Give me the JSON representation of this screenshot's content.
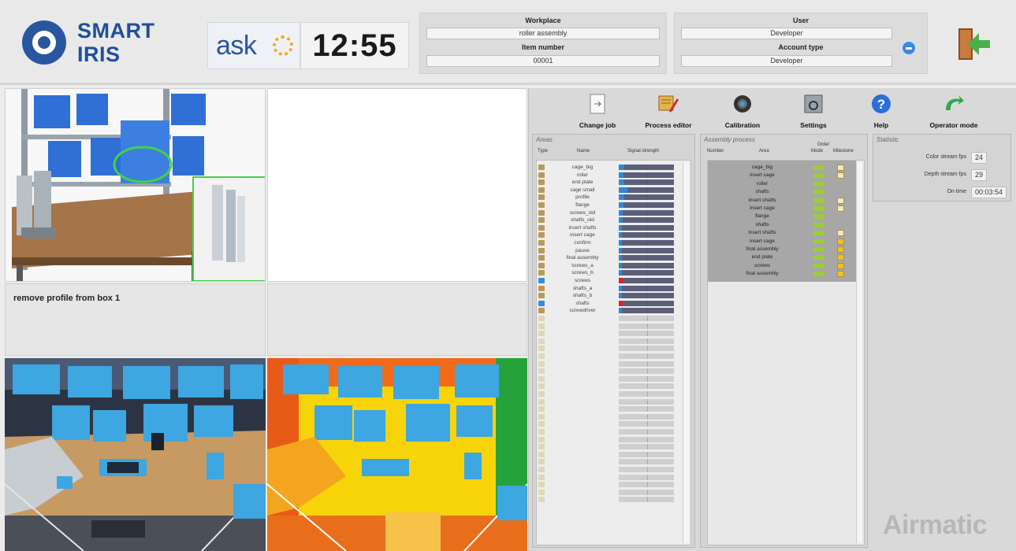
{
  "header": {
    "logo_text_line1": "SMART",
    "logo_text_line2": "IRIS",
    "ask_logo": "ask",
    "clock": "12:55",
    "workplace_label": "Workplace",
    "workplace_value": "roller assembly",
    "item_label": "Item number",
    "item_value": "00001",
    "user_label": "User",
    "user_value": "Developer",
    "account_label": "Account type",
    "account_value": "Developer",
    "exit_icon": "exit-door-icon"
  },
  "instruction": "remove profile from box 1",
  "toolbar": [
    {
      "label": "Change job",
      "icon": "change-job-icon"
    },
    {
      "label": "Process editor",
      "icon": "process-editor-icon"
    },
    {
      "label": "Calibration",
      "icon": "calibration-icon"
    },
    {
      "label": "Settings",
      "icon": "settings-icon"
    },
    {
      "label": "Help",
      "icon": "help-icon"
    },
    {
      "label": "Operator mode",
      "icon": "operator-mode-icon"
    }
  ],
  "areas": {
    "title": "Areas",
    "col_type": "Type",
    "col_name": "Name",
    "col_signal": "Signal strength",
    "items": [
      {
        "type": "box",
        "name": "cage_big",
        "signal": 0.1
      },
      {
        "type": "box",
        "name": "roller",
        "signal": 0.08
      },
      {
        "type": "box",
        "name": "end plate",
        "signal": 0.1
      },
      {
        "type": "box",
        "name": "cage small",
        "signal": 0.15
      },
      {
        "type": "box",
        "name": "profile",
        "signal": 0.1
      },
      {
        "type": "box",
        "name": "flange",
        "signal": 0.08
      },
      {
        "type": "box",
        "name": "screws_old",
        "signal": 0.07
      },
      {
        "type": "box",
        "name": "shafts_old",
        "signal": 0.07
      },
      {
        "type": "box",
        "name": "insert shafts",
        "signal": 0.06
      },
      {
        "type": "box",
        "name": "insert cage",
        "signal": 0.06
      },
      {
        "type": "box",
        "name": "confirm",
        "signal": 0.05
      },
      {
        "type": "box",
        "name": "pause",
        "signal": 0.05
      },
      {
        "type": "box",
        "name": "final assembly",
        "signal": 0.05
      },
      {
        "type": "box",
        "name": "screws_a",
        "signal": 0.06
      },
      {
        "type": "box",
        "name": "screws_b",
        "signal": 0.06
      },
      {
        "type": "tool",
        "name": "screws",
        "signal": 0.07
      },
      {
        "type": "box",
        "name": "shafts_a",
        "signal": 0.06
      },
      {
        "type": "box",
        "name": "shafts_b",
        "signal": 0.06
      },
      {
        "type": "tool",
        "name": "shafts",
        "signal": 0.07
      },
      {
        "type": "box",
        "name": "screwdriver",
        "signal": 0.06
      }
    ],
    "empty_rows": 25
  },
  "assembly": {
    "title": "Assembly process",
    "col_number": "Number",
    "col_area": "Area",
    "col_order": "Order",
    "col_mode": "Mode",
    "col_milestone": "Milestone",
    "items": [
      {
        "area": "cage_big",
        "milestone": false
      },
      {
        "area": "insert cage",
        "milestone": false
      },
      {
        "area": "roller",
        "milestone": null
      },
      {
        "area": "shafts",
        "milestone": null
      },
      {
        "area": "insert shafts",
        "milestone": false
      },
      {
        "area": "insert cage",
        "milestone": false
      },
      {
        "area": "flange",
        "milestone": null
      },
      {
        "area": "shafts",
        "milestone": null
      },
      {
        "area": "insert shafts",
        "milestone": false
      },
      {
        "area": "insert cage",
        "milestone": true
      },
      {
        "area": "final assembly",
        "milestone": true
      },
      {
        "area": "end plate",
        "milestone": true
      },
      {
        "area": "screws",
        "milestone": true
      },
      {
        "area": "final assembly",
        "milestone": true
      }
    ]
  },
  "statistic": {
    "title": "Statistic",
    "color_label": "Color stream fps",
    "color_value": "24",
    "depth_label": "Depth stream fps",
    "depth_value": "29",
    "ontime_label": "On time",
    "ontime_value": "00:03:54"
  },
  "brand": "Airmatic",
  "colors": {
    "brand_blue": "#1f4e9b",
    "signal_fill": "#2e86d8",
    "signal_bar": "#5b5f7a",
    "mode_green": "#9ccc3a",
    "milestone_yellow": "#f0c020"
  }
}
